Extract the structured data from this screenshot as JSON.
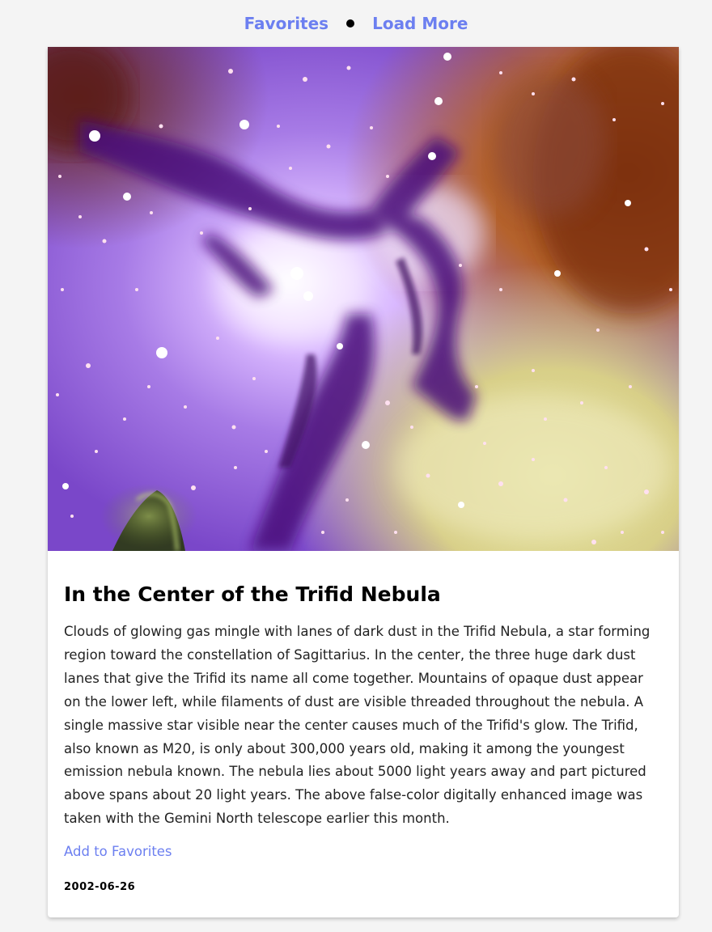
{
  "nav": {
    "favorites_label": "Favorites",
    "load_more_label": "Load More",
    "link_color": "#6c7ff0"
  },
  "post": {
    "title": "In the Center of the Trifid Nebula",
    "image_alt": "Trifid Nebula (M20) false-color image: purple and pink glowing gas, dark dust lanes, orange-brown dust cloud at right, yellow-green glow at lower right, scattered bright stars",
    "description": "Clouds of glowing gas mingle with lanes of dark dust in the Trifid Nebula, a star forming region toward the constellation of Sagittarius. In the center, the three huge dark dust lanes that give the Trifid its name all come together. Mountains of opaque dust appear on the lower left, while filaments of dust are visible threaded throughout the nebula. A single massive star visible near the center causes much of the Trifid's glow. The Trifid, also known as M20, is only about 300,000 years old, making it among the youngest emission nebula known. The nebula lies about 5000 light years away and part pictured above spans about 20 light years. The above false-color digitally enhanced image was taken with the Gemini North telescope earlier this month.",
    "add_favorite_label": "Add to Favorites",
    "date": "2002-06-26"
  }
}
